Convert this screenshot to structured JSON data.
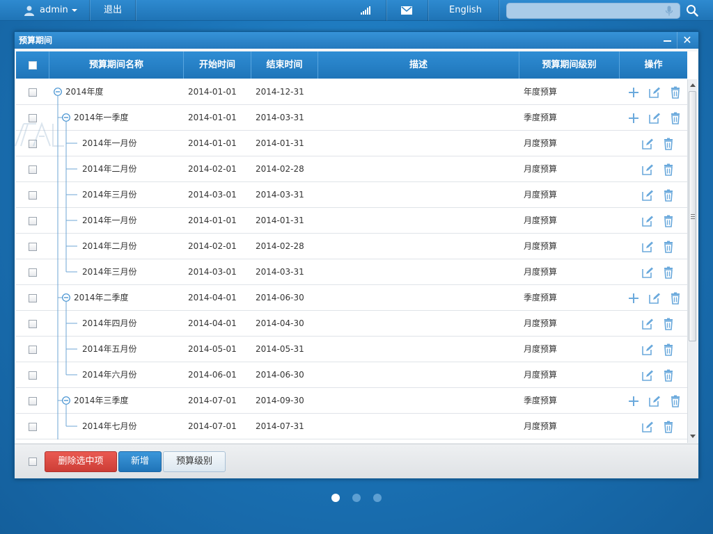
{
  "topbar": {
    "user": "admin",
    "logout": "退出",
    "language": "English",
    "search_placeholder": ""
  },
  "window": {
    "title": "预算期间",
    "minimize_label": "",
    "close_label": "✕"
  },
  "table": {
    "columns": {
      "name": "预算期间名称",
      "start": "开始时间",
      "end": "结束时间",
      "desc": "描述",
      "level": "预算期间级别",
      "ops": "操作"
    },
    "rows": [
      {
        "name": "2014年度",
        "start": "2014-01-01",
        "end": "2014-12-31",
        "level": "年度预算",
        "depth": 0
      },
      {
        "name": "2014年一季度",
        "start": "2014-01-01",
        "end": "2014-03-31",
        "level": "季度预算",
        "depth": 1
      },
      {
        "name": "2014年一月份",
        "start": "2014-01-01",
        "end": "2014-01-31",
        "level": "月度预算",
        "depth": 2
      },
      {
        "name": "2014年二月份",
        "start": "2014-02-01",
        "end": "2014-02-28",
        "level": "月度预算",
        "depth": 2
      },
      {
        "name": "2014年三月份",
        "start": "2014-03-01",
        "end": "2014-03-31",
        "level": "月度预算",
        "depth": 2
      },
      {
        "name": "2014年一月份",
        "start": "2014-01-01",
        "end": "2014-01-31",
        "level": "月度预算",
        "depth": 2
      },
      {
        "name": "2014年二月份",
        "start": "2014-02-01",
        "end": "2014-02-28",
        "level": "月度预算",
        "depth": 2
      },
      {
        "name": "2014年三月份",
        "start": "2014-03-01",
        "end": "2014-03-31",
        "level": "月度预算",
        "depth": 2
      },
      {
        "name": "2014年二季度",
        "start": "2014-04-01",
        "end": "2014-06-30",
        "level": "季度预算",
        "depth": 1
      },
      {
        "name": "2014年四月份",
        "start": "2014-04-01",
        "end": "2014-04-30",
        "level": "月度预算",
        "depth": 2
      },
      {
        "name": "2014年五月份",
        "start": "2014-05-01",
        "end": "2014-05-31",
        "level": "月度预算",
        "depth": 2
      },
      {
        "name": "2014年六月份",
        "start": "2014-06-01",
        "end": "2014-06-30",
        "level": "月度预算",
        "depth": 2
      },
      {
        "name": "2014年三季度",
        "start": "2014-07-01",
        "end": "2014-09-30",
        "level": "季度预算",
        "depth": 1
      },
      {
        "name": "2014年七月份",
        "start": "2014-07-01",
        "end": "2014-07-31",
        "level": "月度预算",
        "depth": 2
      }
    ]
  },
  "footer": {
    "delete_selected": "删除选中项",
    "add": "新增",
    "budget_level": "预算级别"
  },
  "pager": {
    "count": 3,
    "active": 0
  },
  "icons": {
    "user": "user-icon",
    "signal": "signal-icon",
    "mail": "mail-icon",
    "mic": "mic-icon",
    "search": "search-icon",
    "collapse": "minus-circle-icon",
    "add": "plus-icon",
    "edit": "edit-icon",
    "delete": "trash-icon"
  },
  "colors": {
    "accent": "#1f75b9",
    "danger": "#d9443d",
    "icon": "#6aa9dc"
  }
}
